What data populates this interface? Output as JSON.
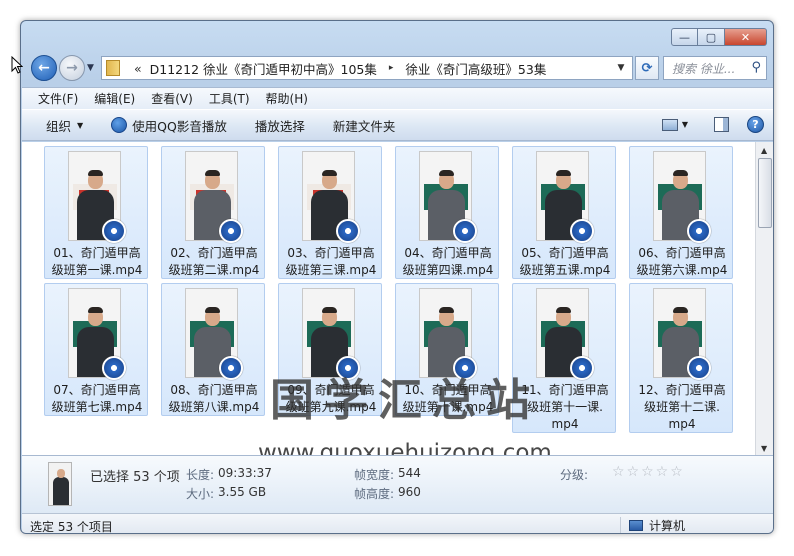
{
  "window": {
    "address": {
      "chevron": "«",
      "segments": [
        "D11212 徐业《奇门遁甲初中高》105集",
        "徐业《奇门高级班》53集"
      ],
      "separator": "▸"
    },
    "search_placeholder": "搜索 徐业...",
    "caption": {
      "minimize": "—",
      "maximize": "▢",
      "close": "✕"
    }
  },
  "menu": [
    "文件(F)",
    "编辑(E)",
    "查看(V)",
    "工具(T)",
    "帮助(H)"
  ],
  "toolbar": {
    "organize": "组织",
    "play_qq": "使用QQ影音播放",
    "play_selection": "播放选择",
    "new_folder": "新建文件夹"
  },
  "files": [
    {
      "line1": "01、奇门遁甲高",
      "line2": "级班第一课.mp4",
      "board": "red"
    },
    {
      "line1": "02、奇门遁甲高",
      "line2": "级班第二课.mp4",
      "board": "red"
    },
    {
      "line1": "03、奇门遁甲高",
      "line2": "级班第三课.mp4",
      "board": "red"
    },
    {
      "line1": "04、奇门遁甲高",
      "line2": "级班第四课.mp4",
      "board": "green"
    },
    {
      "line1": "05、奇门遁甲高",
      "line2": "级班第五课.mp4",
      "board": "green"
    },
    {
      "line1": "06、奇门遁甲高",
      "line2": "级班第六课.mp4",
      "board": "green"
    },
    {
      "line1": "07、奇门遁甲高",
      "line2": "级班第七课.mp4",
      "board": "green"
    },
    {
      "line1": "08、奇门遁甲高",
      "line2": "级班第八课.mp4",
      "board": "green"
    },
    {
      "line1": "09、奇门遁甲高",
      "line2": "级班第九课.mp4",
      "board": "green"
    },
    {
      "line1": "10、奇门遁甲高",
      "line2": "级班第十课.mp4",
      "board": "green"
    },
    {
      "line1": "11、奇门遁甲高",
      "line2": "级班第十一课.",
      "line3": "mp4",
      "board": "green"
    },
    {
      "line1": "12、奇门遁甲高",
      "line2": "级班第十二课.",
      "line3": "mp4",
      "board": "green"
    }
  ],
  "watermark": {
    "name": "国学汇总站",
    "url": "www.guoxuehuizong.com"
  },
  "details": {
    "selected": "已选择 53 个项",
    "length_label": "长度:",
    "length_value": "09:33:37",
    "size_label": "大小:",
    "size_value": "3.55 GB",
    "width_label": "帧宽度:",
    "width_value": "544",
    "height_label": "帧高度:",
    "height_value": "960",
    "rating_label": "分级:",
    "rating_stars": "☆☆☆☆☆"
  },
  "status": {
    "left": "选定 53 个项目",
    "right": "计算机"
  }
}
